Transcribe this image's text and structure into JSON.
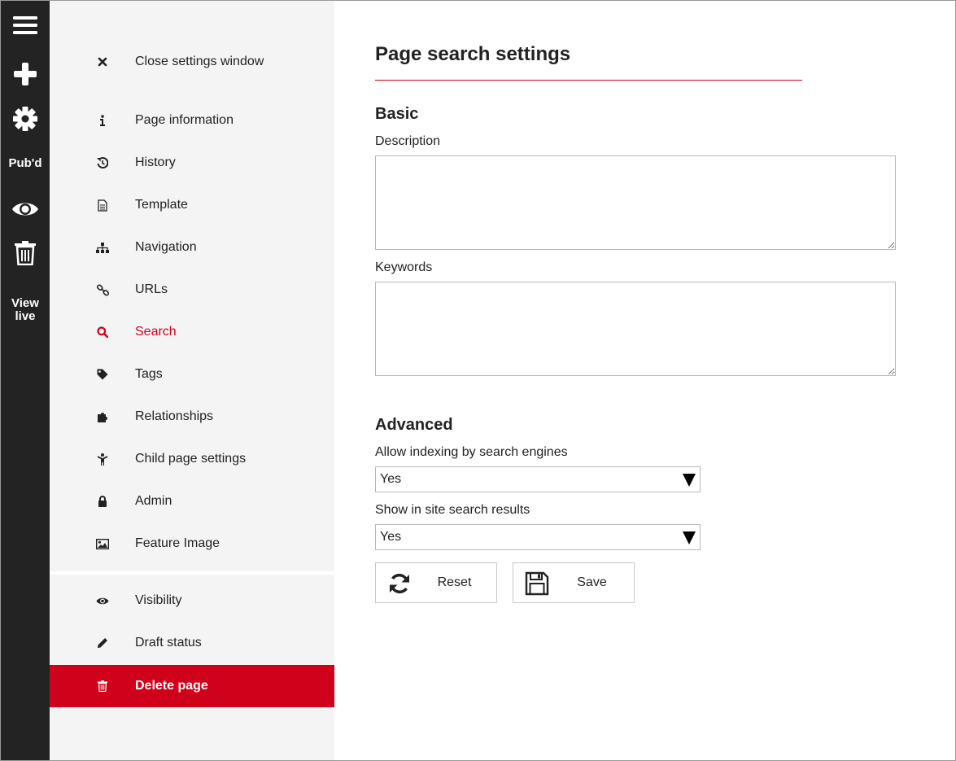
{
  "toolbar": {
    "items": [
      {
        "name": "menu",
        "icon": "hamburger-menu-icon"
      },
      {
        "name": "add",
        "icon": "plus-icon"
      },
      {
        "name": "settings",
        "icon": "gear-icon"
      },
      {
        "name": "status",
        "label": "Pub'd"
      },
      {
        "name": "preview",
        "icon": "eye-icon"
      },
      {
        "name": "delete",
        "icon": "trash-icon"
      },
      {
        "name": "view-live",
        "label_line1": "View",
        "label_line2": "live"
      }
    ]
  },
  "panel": {
    "close_label": "Close settings window",
    "items": [
      {
        "label": "Page information",
        "icon": "info-icon"
      },
      {
        "label": "History",
        "icon": "history-icon"
      },
      {
        "label": "Template",
        "icon": "document-icon"
      },
      {
        "label": "Navigation",
        "icon": "sitemap-icon"
      },
      {
        "label": "URLs",
        "icon": "link-icon"
      },
      {
        "label": "Search",
        "icon": "search-icon",
        "active": true
      },
      {
        "label": "Tags",
        "icon": "tag-icon"
      },
      {
        "label": "Relationships",
        "icon": "puzzle-icon"
      },
      {
        "label": "Child page settings",
        "icon": "child-icon"
      },
      {
        "label": "Admin",
        "icon": "lock-icon"
      },
      {
        "label": "Feature Image",
        "icon": "image-icon"
      }
    ],
    "lower_items": [
      {
        "label": "Visibility",
        "icon": "eye-icon"
      },
      {
        "label": "Draft status",
        "icon": "pencil-icon"
      }
    ],
    "delete_label": "Delete page"
  },
  "main": {
    "title": "Page search settings",
    "basic": {
      "heading": "Basic",
      "description_label": "Description",
      "description_value": "",
      "keywords_label": "Keywords",
      "keywords_value": ""
    },
    "advanced": {
      "heading": "Advanced",
      "indexing_label": "Allow indexing by search engines",
      "indexing_value": "Yes",
      "site_search_label": "Show in site search results",
      "site_search_value": "Yes"
    },
    "buttons": {
      "reset_label": "Reset",
      "save_label": "Save"
    }
  },
  "colors": {
    "accent": "#d0021b",
    "toolbar_bg": "#232323",
    "panel_bg": "#f4f4f4"
  }
}
